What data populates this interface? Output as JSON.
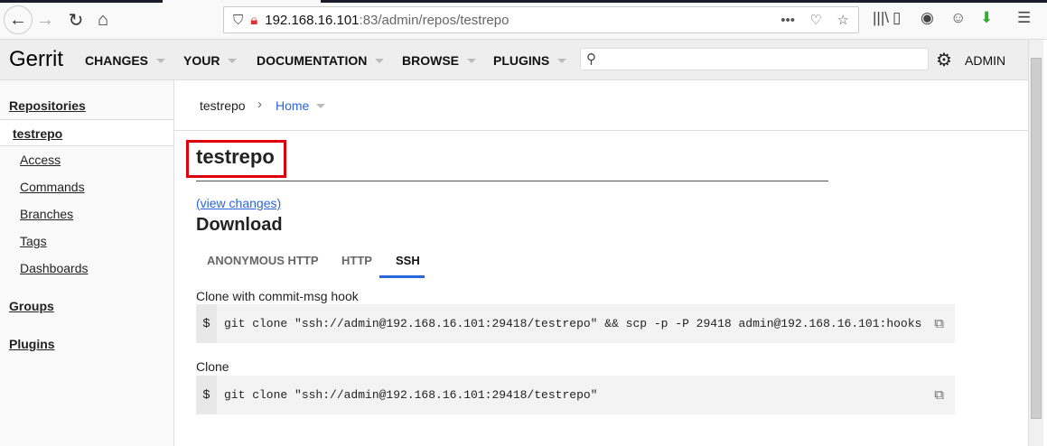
{
  "browser": {
    "url_host": "192.168.16.101",
    "url_rest": ":83/admin/repos/testrepo"
  },
  "header": {
    "logo": "Gerrit",
    "menus": [
      "CHANGES",
      "YOUR",
      "DOCUMENTATION",
      "BROWSE",
      "PLUGINS"
    ],
    "search_placeholder": "",
    "user": "ADMIN"
  },
  "sidebar": {
    "repositories": "Repositories",
    "repo": "testrepo",
    "items": [
      "Access",
      "Commands",
      "Branches",
      "Tags",
      "Dashboards"
    ],
    "groups": "Groups",
    "plugins": "Plugins"
  },
  "main": {
    "breadcrumb_repo": "testrepo",
    "breadcrumb_page": "Home",
    "title": "testrepo",
    "view_changes": "(view changes)",
    "download": "Download",
    "tabs": [
      "ANONYMOUS HTTP",
      "HTTP",
      "SSH"
    ],
    "active_tab": "SSH",
    "commands": [
      {
        "label": "Clone with commit-msg hook",
        "prompt": "$",
        "cmd": "git clone \"ssh://admin@192.168.16.101:29418/testrepo\" && scp -p -P 29418 admin@192.168.16.101:hooks"
      },
      {
        "label": "Clone",
        "prompt": "$",
        "cmd": "git clone \"ssh://admin@192.168.16.101:29418/testrepo\""
      }
    ]
  },
  "colors": {
    "accent": "#2a66d9",
    "highlight_box": "#e0000a"
  }
}
